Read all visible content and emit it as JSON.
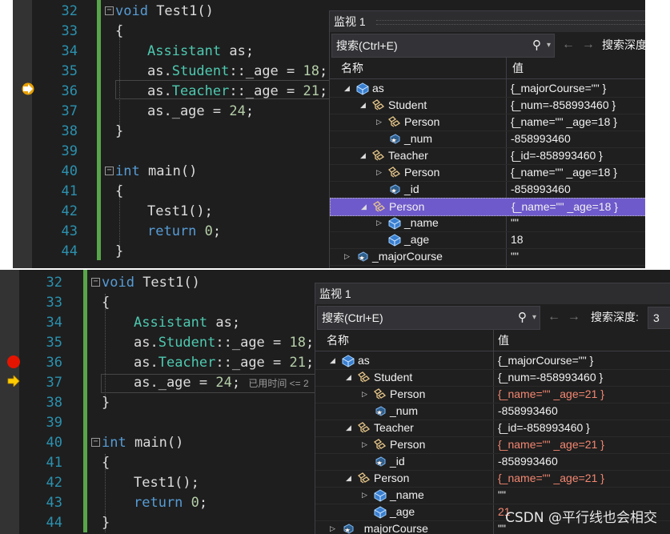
{
  "code_lines": [
    {
      "n": "32",
      "t": "void Test1()"
    },
    {
      "n": "33",
      "t": "{"
    },
    {
      "n": "34",
      "t": "Assistant as;"
    },
    {
      "n": "35",
      "t": "as.Student::_age = 18;"
    },
    {
      "n": "36",
      "t": "as.Teacher::_age = 21;"
    },
    {
      "n": "37",
      "t": "as._age = 24;"
    },
    {
      "n": "38",
      "t": "}"
    },
    {
      "n": "39",
      "t": ""
    },
    {
      "n": "40",
      "t": "int main()"
    },
    {
      "n": "41",
      "t": "{"
    },
    {
      "n": "42",
      "t": "Test1();"
    },
    {
      "n": "43",
      "t": "return 0;"
    },
    {
      "n": "44",
      "t": "}"
    }
  ],
  "timing_hint": "已用时间 <= 2",
  "watch1": {
    "title": "监视 1",
    "search_placeholder": "搜索(Ctrl+E)",
    "depth_label": "搜索深度",
    "col_name": "名称",
    "col_value": "值",
    "rows": [
      {
        "name": "as",
        "value": "{_majorCourse=\"\" }",
        "expand": "◢",
        "icon": "object"
      },
      {
        "name": "Student",
        "value": "{_num=-858993460 }",
        "expand": "◢",
        "icon": "class"
      },
      {
        "name": "Person",
        "value": "{_name=\"\" _age=18 }",
        "expand": "▷",
        "icon": "class"
      },
      {
        "name": "_num",
        "value": "-858993460",
        "expand": "",
        "icon": "field"
      },
      {
        "name": "Teacher",
        "value": "{_id=-858993460 }",
        "expand": "◢",
        "icon": "class"
      },
      {
        "name": "Person",
        "value": "{_name=\"\" _age=18 }",
        "expand": "▷",
        "icon": "class"
      },
      {
        "name": "_id",
        "value": "-858993460",
        "expand": "",
        "icon": "field"
      },
      {
        "name": "Person",
        "value": "{_name=\"\" _age=18 }",
        "expand": "◢",
        "icon": "class"
      },
      {
        "name": "_name",
        "value": "\"\"",
        "expand": "▷",
        "icon": "object"
      },
      {
        "name": "_age",
        "value": "18",
        "expand": "",
        "icon": "object"
      },
      {
        "name": "_majorCourse",
        "value": "\"\"",
        "expand": "▷",
        "icon": "field"
      }
    ]
  },
  "watch2": {
    "title": "监视 1",
    "search_placeholder": "搜索(Ctrl+E)",
    "depth_label": "搜索深度:",
    "depth_value": "3",
    "col_name": "名称",
    "col_value": "值",
    "rows": [
      {
        "name": "as",
        "value": "{_majorCourse=\"\" }",
        "expand": "◢",
        "icon": "object",
        "changed": false
      },
      {
        "name": "Student",
        "value": "{_num=-858993460 }",
        "expand": "◢",
        "icon": "class",
        "changed": false
      },
      {
        "name": "Person",
        "value": "{_name=\"\" _age=21 }",
        "expand": "▷",
        "icon": "class",
        "changed": true
      },
      {
        "name": "_num",
        "value": "-858993460",
        "expand": "",
        "icon": "field",
        "changed": false
      },
      {
        "name": "Teacher",
        "value": "{_id=-858993460 }",
        "expand": "◢",
        "icon": "class",
        "changed": false
      },
      {
        "name": "Person",
        "value": "{_name=\"\" _age=21 }",
        "expand": "▷",
        "icon": "class",
        "changed": true
      },
      {
        "name": "_id",
        "value": "-858993460",
        "expand": "",
        "icon": "field",
        "changed": false
      },
      {
        "name": "Person",
        "value": "{_name=\"\" _age=21 }",
        "expand": "◢",
        "icon": "class",
        "changed": true
      },
      {
        "name": "_name",
        "value": "\"\"",
        "expand": "▷",
        "icon": "object",
        "changed": false
      },
      {
        "name": "_age",
        "value": "21",
        "expand": "",
        "icon": "object",
        "changed": true
      },
      {
        "name": "_majorCourse",
        "value": "\"\"",
        "expand": "▷",
        "icon": "field",
        "changed": false
      }
    ]
  },
  "watermark": "CSDN @平行线也会相交",
  "colors": {
    "keyword": "#569cd6",
    "type": "#4ec9b0",
    "number": "#b5cea8",
    "line_number": "#2b91af",
    "changed_value": "#f48771",
    "selection": "#6f5acb",
    "breakpoint": "#e51400",
    "arrow": "#ffcc00"
  }
}
